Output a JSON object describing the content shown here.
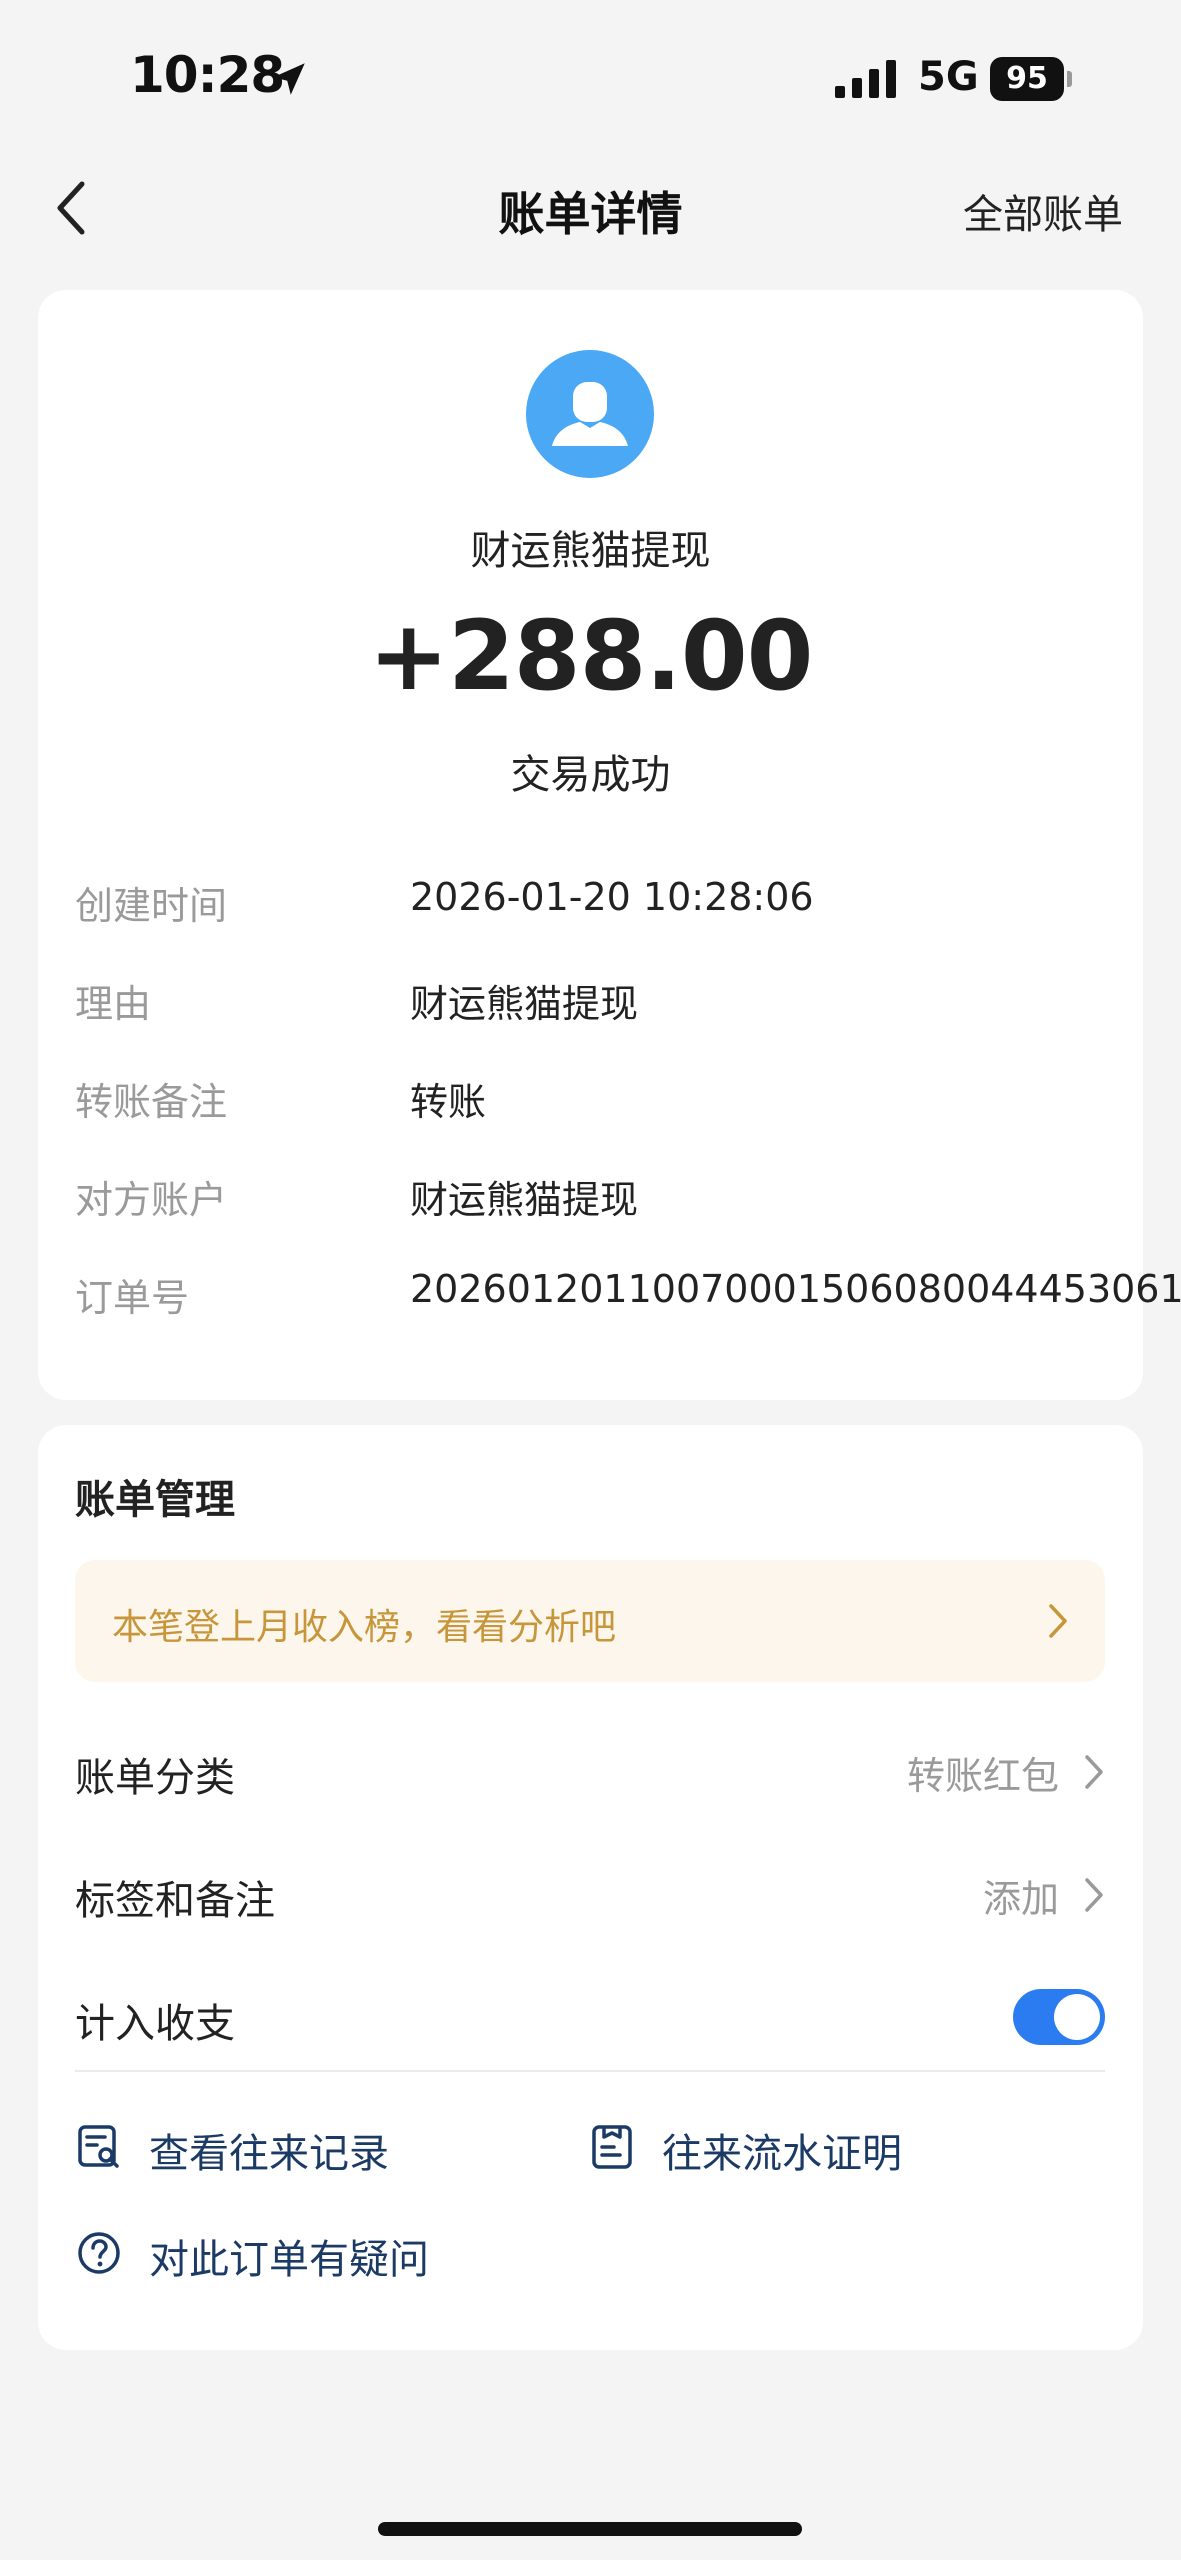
{
  "status_bar": {
    "time": "10:28",
    "network": "5G",
    "battery": "95"
  },
  "nav": {
    "title": "账单详情",
    "right_label": "全部账单"
  },
  "bill": {
    "merchant": "财运熊猫提现",
    "amount": "+288.00",
    "status": "交易成功",
    "details": [
      {
        "label": "创建时间",
        "value": "2026-01-20 10:28:06"
      },
      {
        "label": "理由",
        "value": "财运熊猫提现"
      },
      {
        "label": "转账备注",
        "value": "转账"
      },
      {
        "label": "对方账户",
        "value": "财运熊猫提现"
      },
      {
        "label": "订单号",
        "value": "20260120110070001506080044453061"
      }
    ]
  },
  "management": {
    "title": "账单管理",
    "banner": "本笔登上月收入榜，看看分析吧",
    "category_label": "账单分类",
    "category_value": "转账红包",
    "tag_label": "标签和备注",
    "tag_value": "添加",
    "count_label": "计入收支",
    "count_enabled": true,
    "actions": [
      {
        "label": "查看往来记录",
        "icon": "records-search-icon"
      },
      {
        "label": "往来流水证明",
        "icon": "document-icon"
      },
      {
        "label": "对此订单有疑问",
        "icon": "question-circle-icon"
      }
    ]
  },
  "colors": {
    "accent": "#2b7cf0",
    "link_text": "#1b3a66",
    "banner_text": "#c8963a",
    "avatar": "#4aa8f5"
  }
}
